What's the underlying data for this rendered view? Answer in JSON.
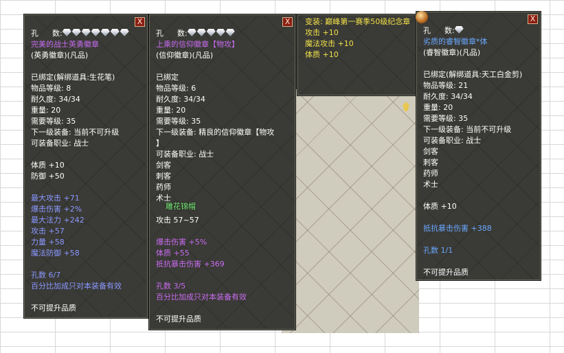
{
  "close_label": "X",
  "panel1": {
    "hole_label": "孔",
    "hole_count_label": "数:",
    "gem_count": 7,
    "name": "完美的战士英勇徽章",
    "type": "(英勇徽章)(凡品)",
    "lines": [
      "已绑定(解绑道具:生花笔)",
      "物品等级: 8",
      "耐久度: 34/34",
      "重量: 20",
      "需要等级: 35",
      "下一级装备: 当前不可升级",
      "可装备职业: 战士"
    ],
    "base_stats": [
      "体质 +10",
      "防御 +50"
    ],
    "bonus_stats": [
      "最大攻击 +71",
      "爆击伤害 +2%",
      "最大法力 +242",
      "攻击      +57",
      "力量      +58",
      "魔法防御 +58"
    ],
    "hole_info": "孔数 6/7",
    "note": "百分比加成只对本装备有效",
    "footer": "不可提升品质"
  },
  "panel2": {
    "hole_label": "孔",
    "hole_count_label": "数:",
    "gem_count": 5,
    "name": "上乘的信仰徽章【物攻】",
    "type": "(信仰徽章)(凡品)",
    "lines": [
      "已绑定",
      "物品等级: 6",
      "耐久度: 34/34",
      "重量: 20",
      "需要等级: 35",
      "下一级装备: 精良的信仰徽章【物攻",
      "】",
      "可装备职业: 战士",
      "剑客",
      "刺客",
      "药师",
      "术士"
    ],
    "attack": "攻击 57~57",
    "bonus_stats": [
      "爆击伤害 +5%",
      "体质      +55",
      "抵抗暴击伤害 +369"
    ],
    "hole_info": "孔数 3/5",
    "note": "百分比加成只对本装备有效",
    "footer": "不可提升品质"
  },
  "panel3": {
    "title": "变装: 巅峰第一赛季50级纪念章",
    "stats": [
      "攻击      +10",
      "魔法攻击 +10",
      "体质      +10"
    ]
  },
  "panel4": {
    "hole_label": "孔",
    "hole_count_label": "数:",
    "gem_count": 1,
    "name": "劣质的睿智徽章*体",
    "type": "(睿智徽章)(凡品)",
    "lines": [
      "已绑定(解绑道具:天工白金剪)",
      "物品等级: 21",
      "耐久度: 34/34",
      "重量: 20",
      "需要等级: 35",
      "下一级装备: 当前不可升级",
      "可装备职业: 战士",
      "剑客",
      "刺客",
      "药师",
      "术士"
    ],
    "base_stats": [
      "体质 +10"
    ],
    "bonus_stats": [
      "抵抗暴击伤害 +388"
    ],
    "hole_info": "孔数 1/1",
    "footer": "不可提升品质"
  },
  "npc_name": "雕花锦帽"
}
